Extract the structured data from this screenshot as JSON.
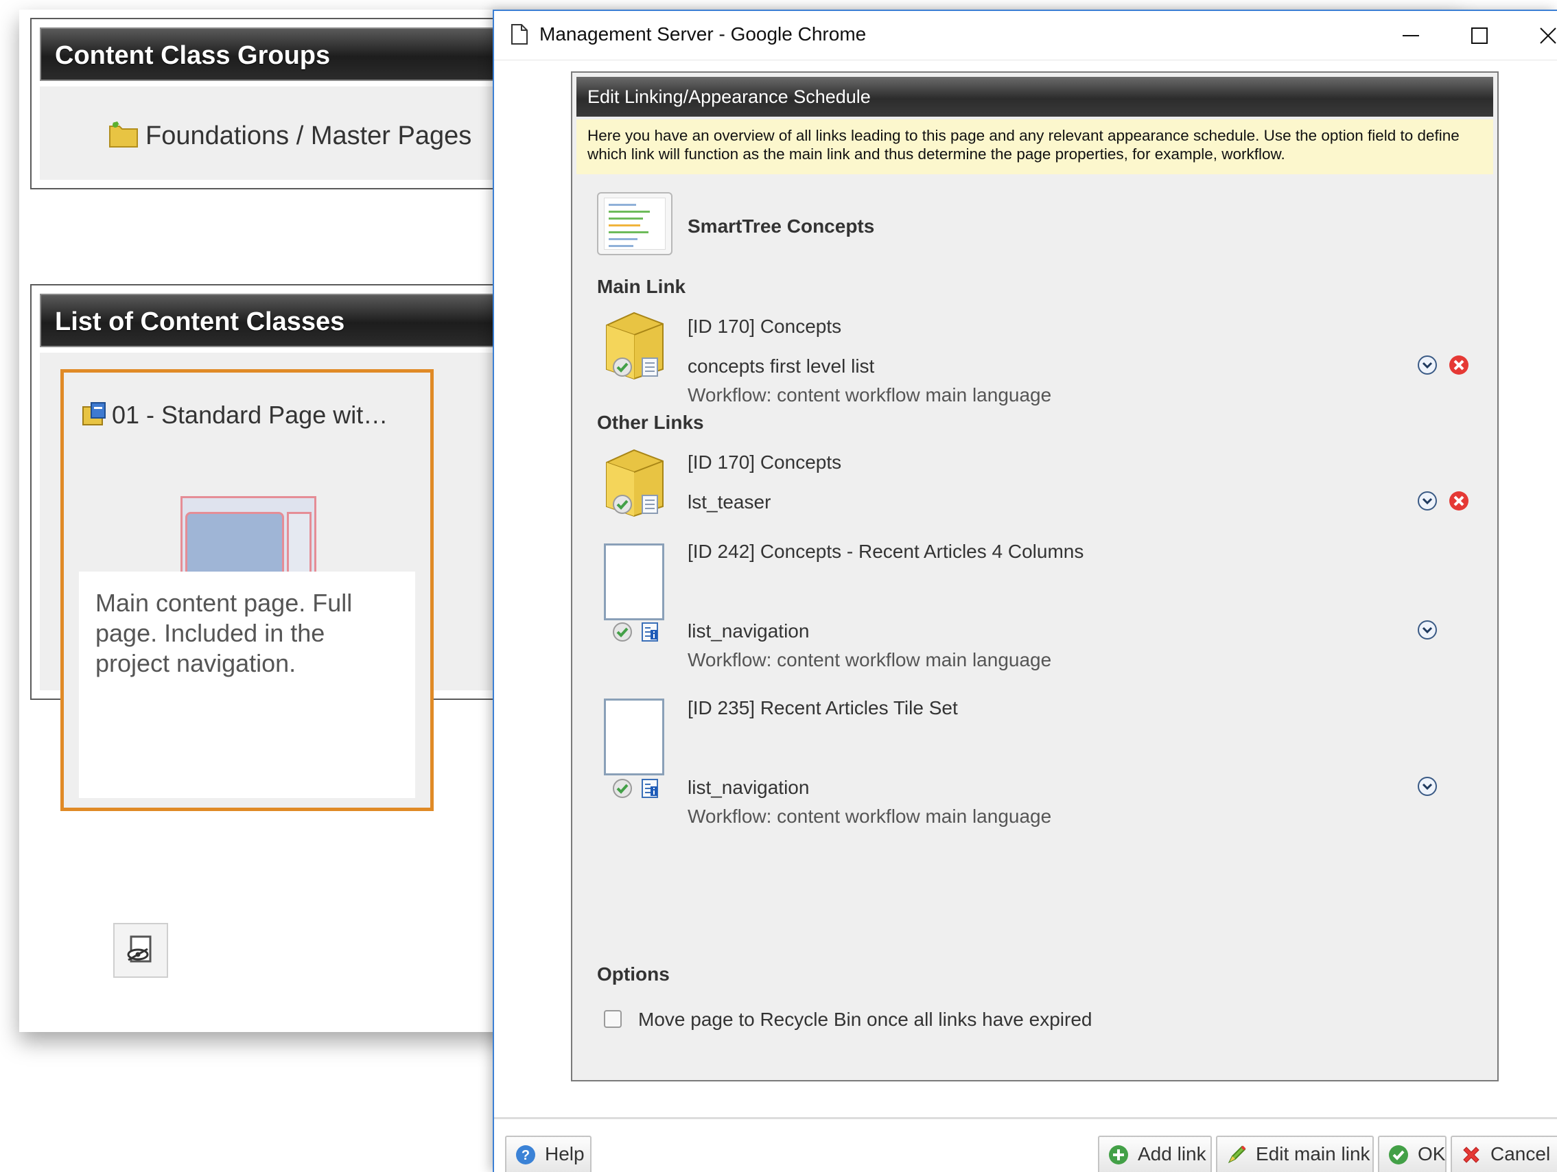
{
  "background_app": {
    "content_class_groups": {
      "header": "Content Class Groups",
      "items": [
        {
          "label": "Foundations / Master Pages",
          "icon": "folder-icon"
        }
      ]
    },
    "list_of_content_classes": {
      "header": "List of Content Classes",
      "cards": [
        {
          "title": "01 - Standard Page wit…",
          "description": "Main content page. Full page. Included in the project navigation.",
          "icon": "content-class-icon",
          "action_icon": "preview-icon"
        }
      ]
    }
  },
  "window": {
    "title": "Management Server - Google Chrome",
    "controls": [
      "minimize-icon",
      "maximize-icon",
      "close-icon"
    ]
  },
  "dialog": {
    "header": "Edit Linking/Appearance Schedule",
    "info": "Here you have an overview of all links leading to this page and any relevant appearance schedule. Use the option field to define which link will function as the main link and thus determine the page properties, for example, workflow.",
    "page": {
      "title": "SmartTree Concepts",
      "thumbnail_icon": "page-thumbnail-icon"
    },
    "main_link_title": "Main Link",
    "main_link": {
      "target": "[ID 170] Concepts",
      "target_icon": "box-icon",
      "link": "concepts first level list",
      "link_icon": "list-icon",
      "workflow": "Workflow: content workflow main language",
      "actions": [
        "expand-icon",
        "delete-icon"
      ]
    },
    "other_links_title": "Other Links",
    "other_links": [
      {
        "target": "[ID 170] Concepts",
        "target_icon": "box-icon",
        "link": "lst_teaser",
        "link_icon": "list-icon",
        "workflow": "",
        "actions": [
          "expand-icon",
          "delete-icon"
        ]
      },
      {
        "target": "[ID 242] Concepts - Recent Articles 4 Columns",
        "target_icon": "empty-page-icon",
        "link": "list_navigation",
        "link_icon": "list-info-icon",
        "workflow": "Workflow: content workflow main language",
        "actions": [
          "expand-icon"
        ]
      },
      {
        "target": "[ID 235] Recent Articles Tile Set",
        "target_icon": "empty-page-icon",
        "link": "list_navigation",
        "link_icon": "list-info-icon",
        "workflow": "Workflow: content workflow main language",
        "actions": [
          "expand-icon"
        ]
      }
    ],
    "options_title": "Options",
    "options": {
      "recycle_label": "Move page to Recycle Bin once all links have expired",
      "recycle_checked": false
    }
  },
  "footer": {
    "help": "Help",
    "add_link": "Add link",
    "edit_main_link": "Edit main link",
    "ok": "OK",
    "cancel": "Cancel"
  },
  "colors": {
    "info_bar": "#fcf7cd",
    "card_border": "#e08a26",
    "active_window_border": "#3b7fd4",
    "status_ok": "#43a047",
    "delete": "#e53935"
  }
}
